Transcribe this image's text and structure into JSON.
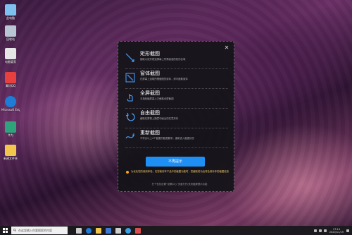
{
  "desktop": {
    "icons": [
      {
        "label": "此电脑",
        "color": "#7ec0ee"
      },
      {
        "label": "回收站",
        "color": "#b8c6d3"
      },
      {
        "label": "电脑管家",
        "color": "#e6e6e6"
      },
      {
        "label": "腾讯QQ",
        "color": "#e83f3f"
      },
      {
        "label": "Microsoft Edge",
        "color": "#1e7bd6"
      },
      {
        "label": "华为",
        "color": "#2fa37b"
      },
      {
        "label": "新建文件夹",
        "color": "#f2c54c"
      }
    ]
  },
  "panel": {
    "options": [
      {
        "title": "矩形截图",
        "desc": "截取以矩形框选屏幕上所需画面的矩形区域",
        "icon": "rect-crop-icon"
      },
      {
        "title": "窗体截图",
        "desc": "在屏幕上选取所需截图的窗体，即可截取窗体",
        "icon": "window-capture-icon"
      },
      {
        "title": "全屏截图",
        "desc": "手指轻触屏幕上方截取全屏截图",
        "icon": "fullscreen-capture-icon"
      },
      {
        "title": "自由截图",
        "desc": "截取在屏幕上随意勾画出的任意形状",
        "icon": "freeform-capture-icon"
      },
      {
        "title": "重新截图",
        "desc": "不符合以上4个截图的截图要求，重新进入截图状态",
        "icon": "retake-capture-icon"
      }
    ],
    "primary_button": "不再提示",
    "notice": "为优化您的使用体验，在您使用本产品中的截图功能时，您截取成功后将会保存你的截图信息",
    "footer": "在个性化设置\"设置中心\"页面打开/关闭截屏提示功能",
    "close_icon": "close-icon"
  },
  "taskbar": {
    "search_placeholder": "在这里输入你要搜索的内容",
    "apps": [
      {
        "name": "task-view-icon",
        "color": "#cfcfcf"
      },
      {
        "name": "edge-icon",
        "color": "#1e7bd6"
      },
      {
        "name": "file-explorer-icon",
        "color": "#f2c54c"
      },
      {
        "name": "store-icon",
        "color": "#3b7bd1"
      },
      {
        "name": "mail-icon",
        "color": "#cfcfcf"
      },
      {
        "name": "browser-icon",
        "color": "#3aa0e6"
      },
      {
        "name": "app-icon",
        "color": "#d94f4f"
      }
    ],
    "time": "17:14",
    "date": "2020/11/19"
  }
}
